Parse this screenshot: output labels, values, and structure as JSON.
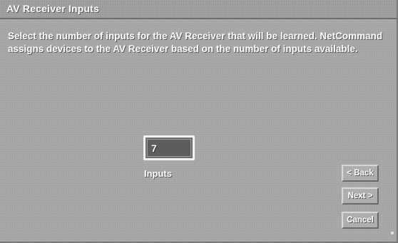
{
  "window": {
    "title": "AV Receiver Inputs"
  },
  "main": {
    "instructions": "Select the number of inputs for the AV Receiver that will be learned. NetCommand assigns devices to the AV Receiver based on the number of inputs available.",
    "inputs_field": {
      "value": "7",
      "label": "Inputs"
    }
  },
  "buttons": {
    "back_label": "< Back",
    "next_label": "Next >",
    "cancel_label": "Cancel"
  },
  "colors": {
    "background": "#a4a4a4",
    "text": "#ffffff",
    "field_fill": "#5d5d5d"
  }
}
